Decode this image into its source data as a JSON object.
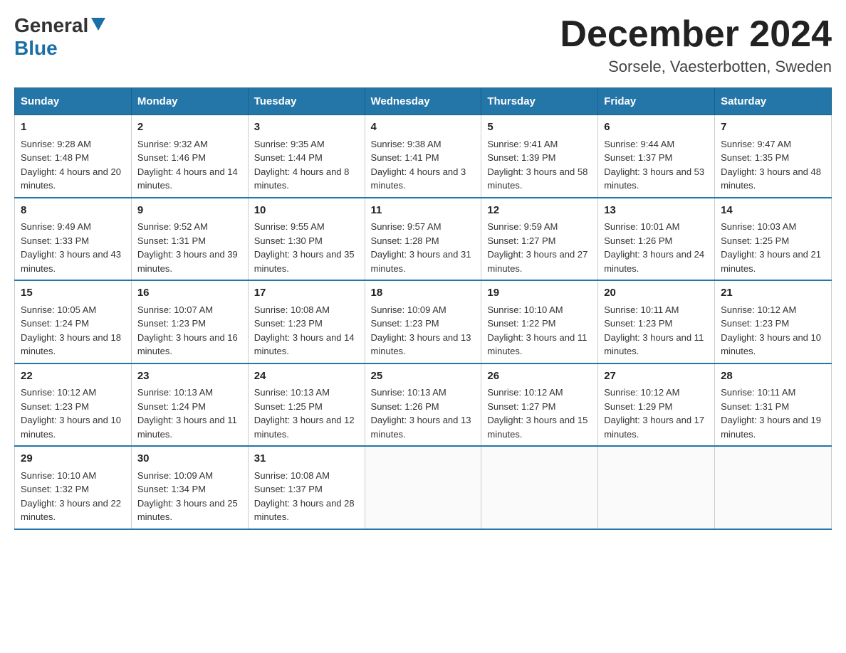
{
  "header": {
    "logo_general": "General",
    "logo_blue": "Blue",
    "month_title": "December 2024",
    "location": "Sorsele, Vaesterbotten, Sweden"
  },
  "days_of_week": [
    "Sunday",
    "Monday",
    "Tuesday",
    "Wednesday",
    "Thursday",
    "Friday",
    "Saturday"
  ],
  "weeks": [
    [
      {
        "day": "1",
        "sunrise": "9:28 AM",
        "sunset": "1:48 PM",
        "daylight": "4 hours and 20 minutes."
      },
      {
        "day": "2",
        "sunrise": "9:32 AM",
        "sunset": "1:46 PM",
        "daylight": "4 hours and 14 minutes."
      },
      {
        "day": "3",
        "sunrise": "9:35 AM",
        "sunset": "1:44 PM",
        "daylight": "4 hours and 8 minutes."
      },
      {
        "day": "4",
        "sunrise": "9:38 AM",
        "sunset": "1:41 PM",
        "daylight": "4 hours and 3 minutes."
      },
      {
        "day": "5",
        "sunrise": "9:41 AM",
        "sunset": "1:39 PM",
        "daylight": "3 hours and 58 minutes."
      },
      {
        "day": "6",
        "sunrise": "9:44 AM",
        "sunset": "1:37 PM",
        "daylight": "3 hours and 53 minutes."
      },
      {
        "day": "7",
        "sunrise": "9:47 AM",
        "sunset": "1:35 PM",
        "daylight": "3 hours and 48 minutes."
      }
    ],
    [
      {
        "day": "8",
        "sunrise": "9:49 AM",
        "sunset": "1:33 PM",
        "daylight": "3 hours and 43 minutes."
      },
      {
        "day": "9",
        "sunrise": "9:52 AM",
        "sunset": "1:31 PM",
        "daylight": "3 hours and 39 minutes."
      },
      {
        "day": "10",
        "sunrise": "9:55 AM",
        "sunset": "1:30 PM",
        "daylight": "3 hours and 35 minutes."
      },
      {
        "day": "11",
        "sunrise": "9:57 AM",
        "sunset": "1:28 PM",
        "daylight": "3 hours and 31 minutes."
      },
      {
        "day": "12",
        "sunrise": "9:59 AM",
        "sunset": "1:27 PM",
        "daylight": "3 hours and 27 minutes."
      },
      {
        "day": "13",
        "sunrise": "10:01 AM",
        "sunset": "1:26 PM",
        "daylight": "3 hours and 24 minutes."
      },
      {
        "day": "14",
        "sunrise": "10:03 AM",
        "sunset": "1:25 PM",
        "daylight": "3 hours and 21 minutes."
      }
    ],
    [
      {
        "day": "15",
        "sunrise": "10:05 AM",
        "sunset": "1:24 PM",
        "daylight": "3 hours and 18 minutes."
      },
      {
        "day": "16",
        "sunrise": "10:07 AM",
        "sunset": "1:23 PM",
        "daylight": "3 hours and 16 minutes."
      },
      {
        "day": "17",
        "sunrise": "10:08 AM",
        "sunset": "1:23 PM",
        "daylight": "3 hours and 14 minutes."
      },
      {
        "day": "18",
        "sunrise": "10:09 AM",
        "sunset": "1:23 PM",
        "daylight": "3 hours and 13 minutes."
      },
      {
        "day": "19",
        "sunrise": "10:10 AM",
        "sunset": "1:22 PM",
        "daylight": "3 hours and 11 minutes."
      },
      {
        "day": "20",
        "sunrise": "10:11 AM",
        "sunset": "1:23 PM",
        "daylight": "3 hours and 11 minutes."
      },
      {
        "day": "21",
        "sunrise": "10:12 AM",
        "sunset": "1:23 PM",
        "daylight": "3 hours and 10 minutes."
      }
    ],
    [
      {
        "day": "22",
        "sunrise": "10:12 AM",
        "sunset": "1:23 PM",
        "daylight": "3 hours and 10 minutes."
      },
      {
        "day": "23",
        "sunrise": "10:13 AM",
        "sunset": "1:24 PM",
        "daylight": "3 hours and 11 minutes."
      },
      {
        "day": "24",
        "sunrise": "10:13 AM",
        "sunset": "1:25 PM",
        "daylight": "3 hours and 12 minutes."
      },
      {
        "day": "25",
        "sunrise": "10:13 AM",
        "sunset": "1:26 PM",
        "daylight": "3 hours and 13 minutes."
      },
      {
        "day": "26",
        "sunrise": "10:12 AM",
        "sunset": "1:27 PM",
        "daylight": "3 hours and 15 minutes."
      },
      {
        "day": "27",
        "sunrise": "10:12 AM",
        "sunset": "1:29 PM",
        "daylight": "3 hours and 17 minutes."
      },
      {
        "day": "28",
        "sunrise": "10:11 AM",
        "sunset": "1:31 PM",
        "daylight": "3 hours and 19 minutes."
      }
    ],
    [
      {
        "day": "29",
        "sunrise": "10:10 AM",
        "sunset": "1:32 PM",
        "daylight": "3 hours and 22 minutes."
      },
      {
        "day": "30",
        "sunrise": "10:09 AM",
        "sunset": "1:34 PM",
        "daylight": "3 hours and 25 minutes."
      },
      {
        "day": "31",
        "sunrise": "10:08 AM",
        "sunset": "1:37 PM",
        "daylight": "3 hours and 28 minutes."
      },
      null,
      null,
      null,
      null
    ]
  ],
  "labels": {
    "sunrise": "Sunrise:",
    "sunset": "Sunset:",
    "daylight": "Daylight:"
  }
}
